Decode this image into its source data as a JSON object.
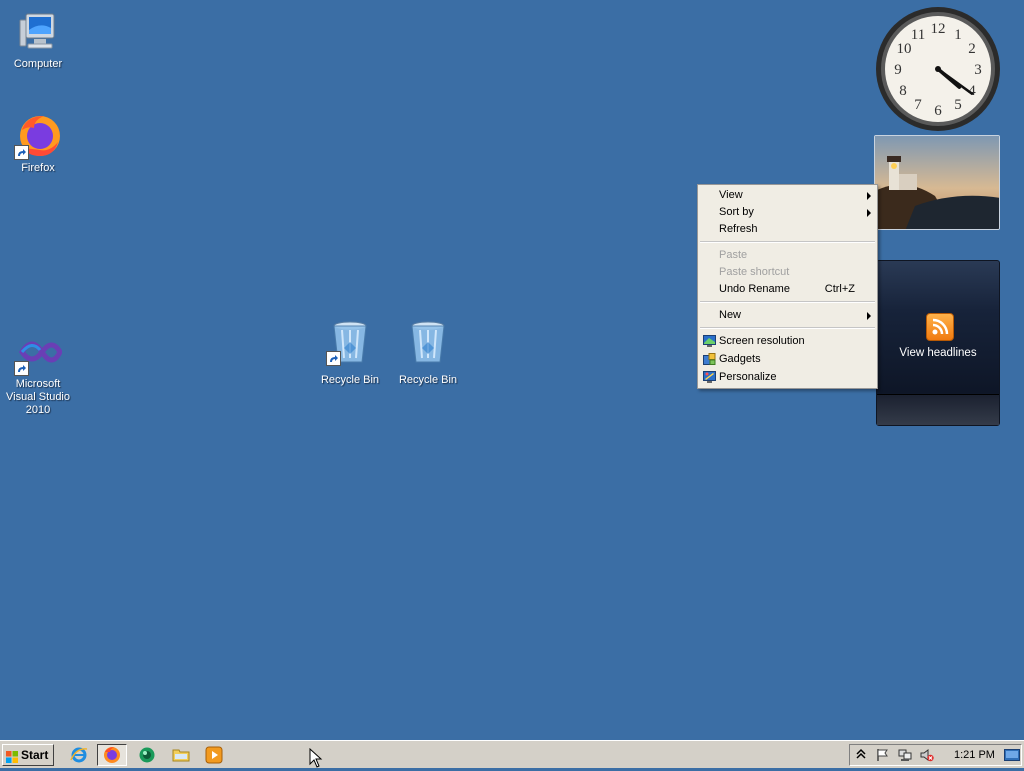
{
  "desktop_icons": {
    "computer": "Computer",
    "firefox": "Firefox",
    "visual_studio": "Microsoft Visual Studio 2010",
    "recycle_bin_shortcut": "Recycle Bin",
    "recycle_bin": "Recycle Bin"
  },
  "gadgets": {
    "clock_time": "4:21",
    "feed_label": "View headlines"
  },
  "context_menu": {
    "view": "View",
    "sort_by": "Sort by",
    "refresh": "Refresh",
    "paste": "Paste",
    "paste_shortcut": "Paste shortcut",
    "undo_rename": "Undo Rename",
    "undo_shortcut": "Ctrl+Z",
    "new": "New",
    "screen_resolution": "Screen resolution",
    "gadgets": "Gadgets",
    "personalize": "Personalize"
  },
  "taskbar": {
    "start_label": "Start",
    "clock": "1:21 PM"
  },
  "icons": [
    "computer-icon",
    "firefox-icon",
    "visual-studio-icon",
    "recycle-bin-icon",
    "rss-icon",
    "ie-icon",
    "firefox-icon",
    "media-center-icon",
    "folder-icon",
    "media-player-icon",
    "show-hidden-icons-icon",
    "action-center-flag-icon",
    "network-icon",
    "volume-muted-icon",
    "show-desktop-icon"
  ],
  "colors": {
    "desktop": "#3b6ea5",
    "menu_bg": "#f0ede4",
    "taskbar": "#d4d0c8"
  }
}
